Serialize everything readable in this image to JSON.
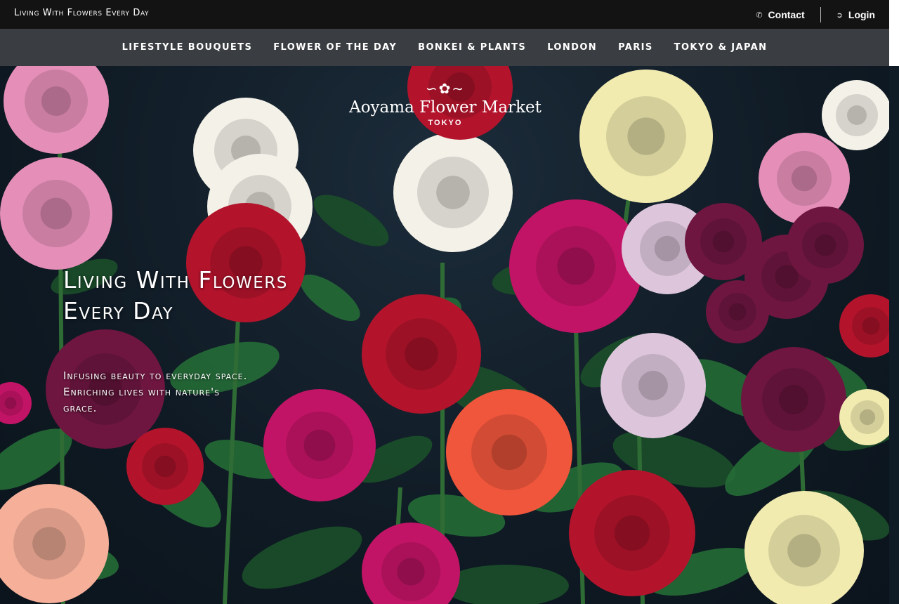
{
  "topbar": {
    "brand_text": "Living With Flowers Every Day",
    "contact_label": "Contact",
    "login_label": "Login",
    "contact_icon": "phone-icon",
    "login_icon": "login-arrow-icon"
  },
  "nav": {
    "items": [
      {
        "label": "LIFESTYLE BOUQUETS"
      },
      {
        "label": "FLOWER OF THE DAY"
      },
      {
        "label": "BONKEI & PLANTS"
      },
      {
        "label": "LONDON"
      },
      {
        "label": "PARIS"
      },
      {
        "label": "TOKYO & JAPAN"
      }
    ]
  },
  "hero": {
    "logo_name": "Aoyama Flower Market",
    "logo_city": "TOKYO",
    "headline": "Living With Flowers Every Day",
    "tagline_lines": [
      "Infusing beauty to everyday space.",
      "Enriching lives with nature's",
      "grace."
    ]
  },
  "colors": {
    "topbar_bg": "#131313",
    "nav_bg": "#3a3d41",
    "hero_bg": "#0f1a24",
    "leaf_green": "#1f5a2e",
    "rose_pink": "#e58fb8",
    "rose_white": "#f3f1e8",
    "rose_red": "#b3142c",
    "rose_magenta": "#c21466",
    "rose_plum": "#6e1640",
    "rose_yellow": "#f2ebb0",
    "rose_coral": "#f0563c",
    "rose_peach": "#f6b09a",
    "rose_lilac": "#ddc6dc"
  }
}
